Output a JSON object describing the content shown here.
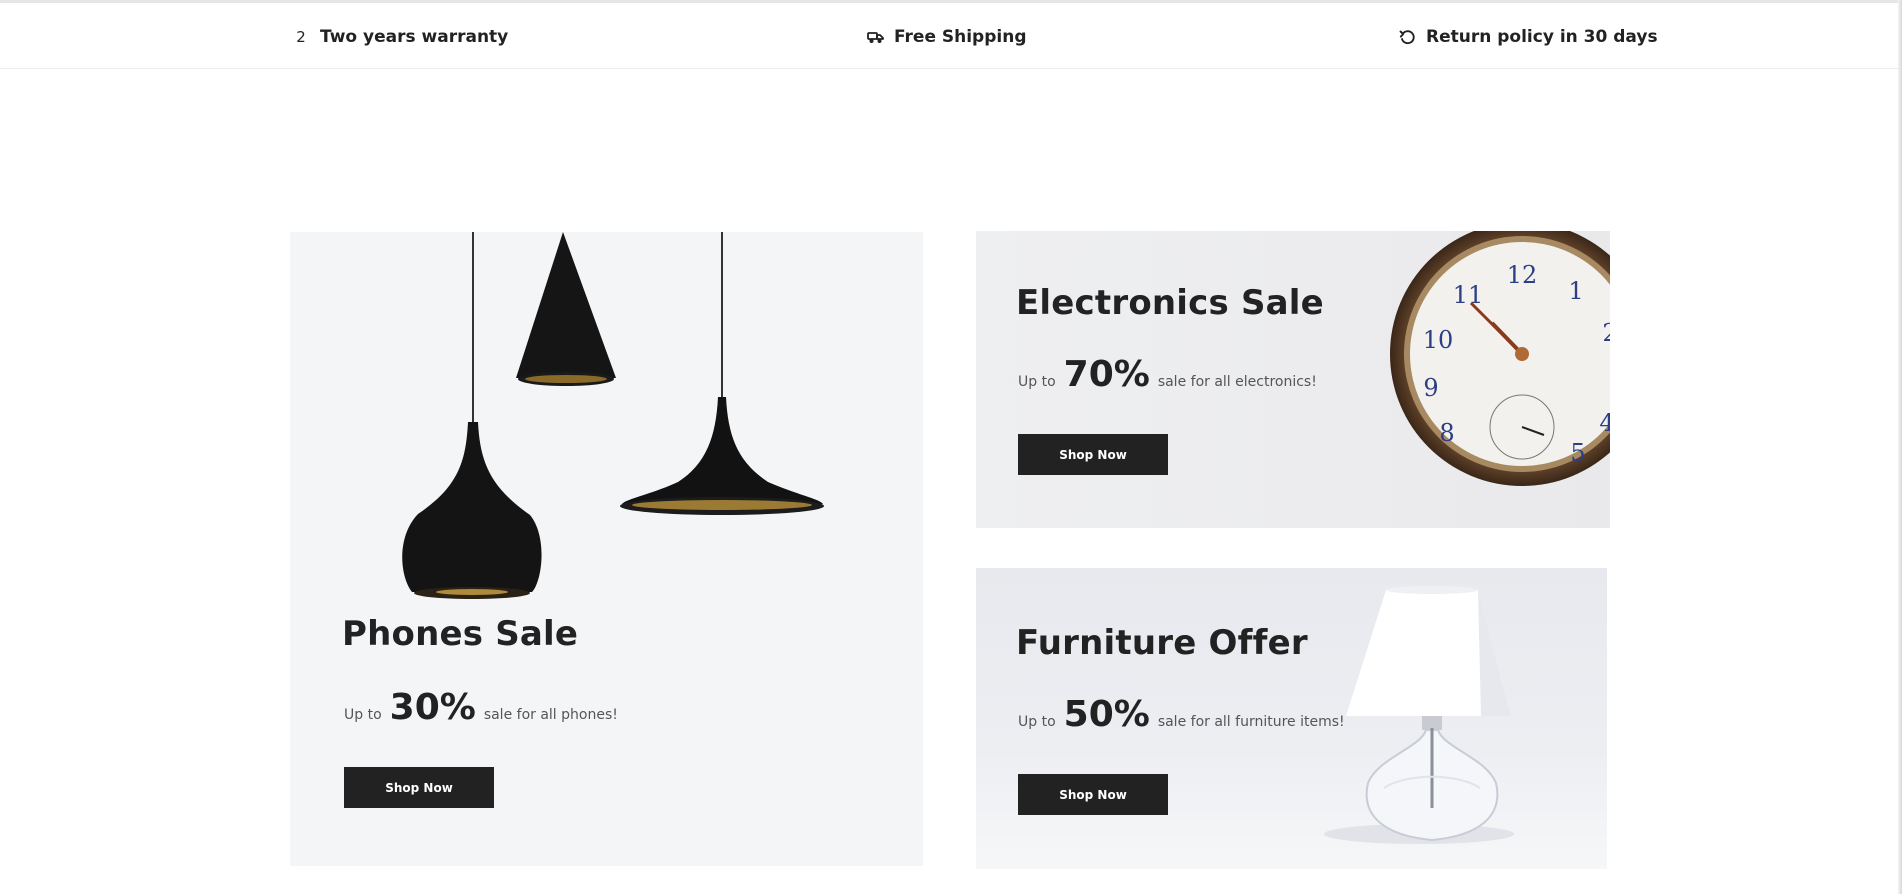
{
  "features": {
    "warranty": {
      "icon": "warranty-icon",
      "glyph": "2",
      "label": "Two years warranty"
    },
    "shipping": {
      "icon": "truck-icon",
      "label": "Free Shipping"
    },
    "returns": {
      "icon": "undo-icon",
      "label": "Return policy in 30 days"
    }
  },
  "banners": {
    "phones": {
      "title": "Phones Sale",
      "up_to": "Up to",
      "percent": "30%",
      "description": "sale for all phones!",
      "button": "Shop Now",
      "image_icon": "pendant-lamps-image"
    },
    "electronics": {
      "title": "Electronics Sale",
      "up_to": "Up to",
      "percent": "70%",
      "description": "sale for all electronics!",
      "button": "Shop Now",
      "image_icon": "pocket-watch-image"
    },
    "furniture": {
      "title": "Furniture Offer",
      "up_to": "Up to",
      "percent": "50%",
      "description": "sale for all furniture items!",
      "button": "Shop Now",
      "image_icon": "table-lamp-image"
    }
  },
  "colors": {
    "button_bg": "#222222",
    "button_text": "#ffffff",
    "banner_bg": "#f4f5f7",
    "text": "#222222"
  }
}
